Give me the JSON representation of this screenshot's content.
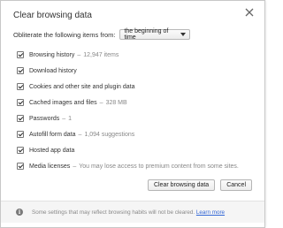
{
  "dialog": {
    "title": "Clear browsing data",
    "close_glyph": "×"
  },
  "range": {
    "label": "Obliterate the following items from:",
    "selected": "the beginning of time"
  },
  "items": [
    {
      "label": "Browsing history",
      "detail": "12,947 items",
      "checked": true
    },
    {
      "label": "Download history",
      "detail": "",
      "checked": true
    },
    {
      "label": "Cookies and other site and plugin data",
      "detail": "",
      "checked": true
    },
    {
      "label": "Cached images and files",
      "detail": "328 MB",
      "checked": true
    },
    {
      "label": "Passwords",
      "detail": "1",
      "checked": true
    },
    {
      "label": "Autofill form data",
      "detail": "1,094 suggestions",
      "checked": true
    },
    {
      "label": "Hosted app data",
      "detail": "",
      "checked": true
    },
    {
      "label": "Media licenses",
      "detail": "You may lose access to premium content from some sites.",
      "checked": true
    }
  ],
  "buttons": {
    "clear_label": "Clear browsing data",
    "cancel_label": "Cancel"
  },
  "footer": {
    "info_glyph": "i",
    "text": "Some settings that may reflect browsing habits will not be cleared.",
    "link": "Learn more"
  }
}
